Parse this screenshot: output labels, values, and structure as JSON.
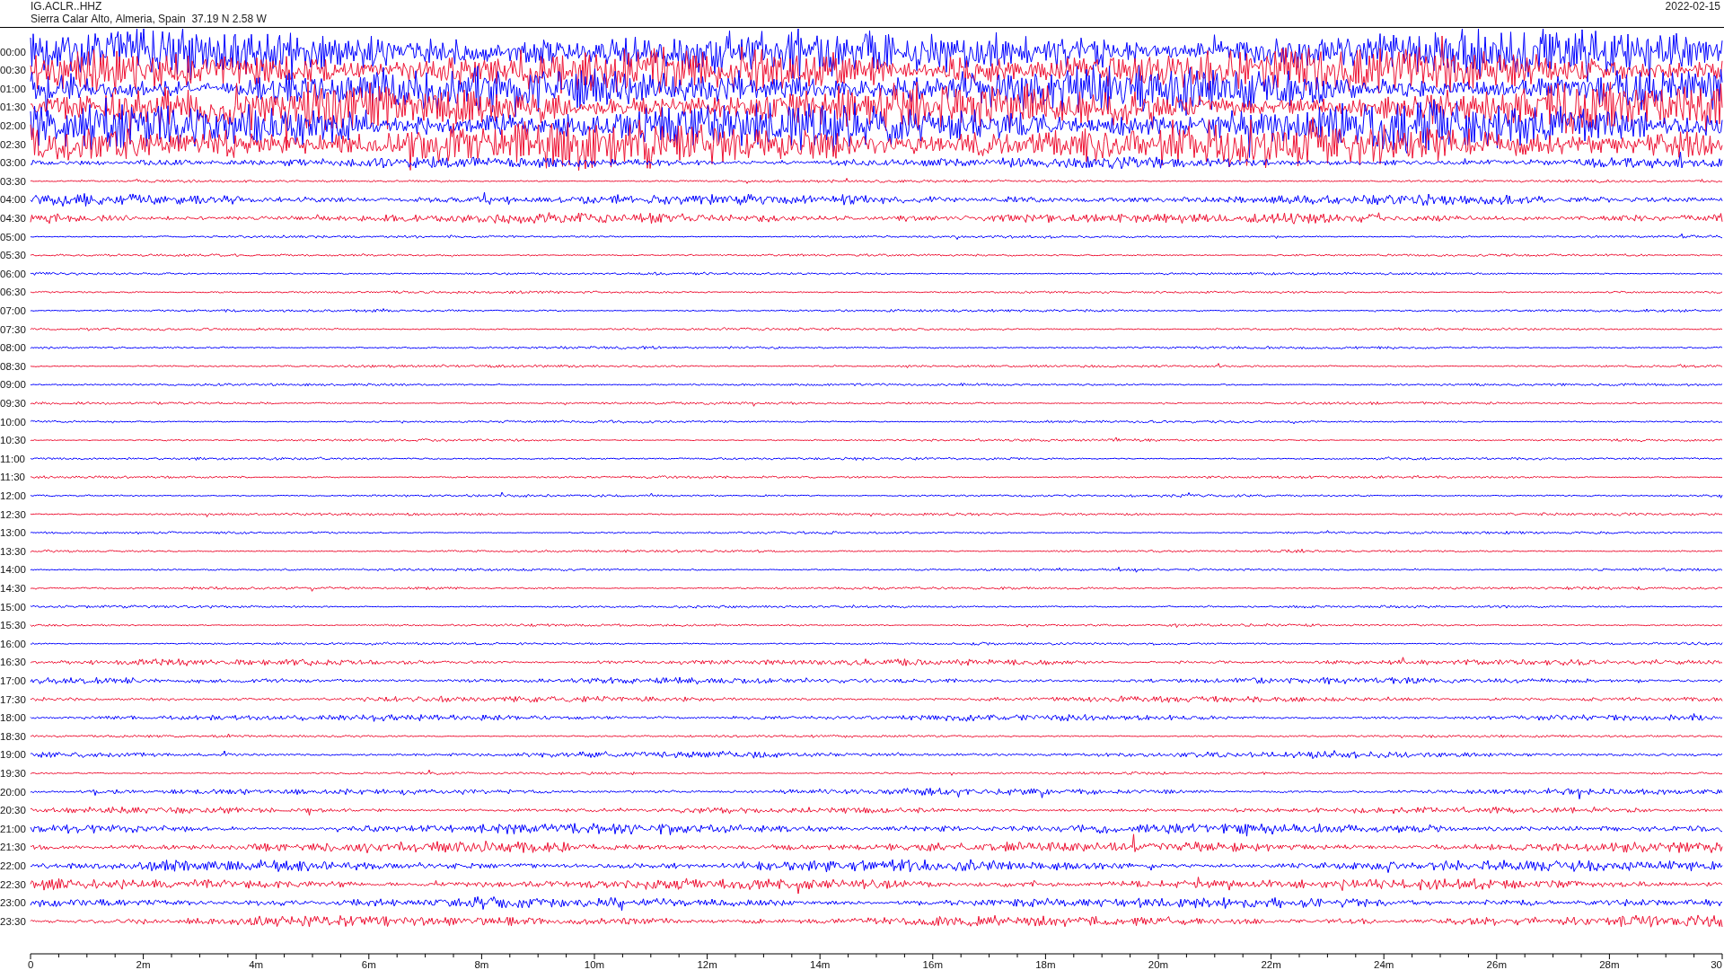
{
  "header": {
    "station": "IG.ACLR..HHZ",
    "location": "Sierra Calar Alto, Almeria, Spain  37.19 N 2.58 W",
    "date": "2022-02-15"
  },
  "traces": [
    {
      "label": "00:00",
      "color": "#0000ff",
      "kind": "saturated"
    },
    {
      "label": "00:30",
      "color": "#ee1133",
      "kind": "saturated"
    },
    {
      "label": "01:00",
      "color": "#0000ff",
      "kind": "saturated"
    },
    {
      "label": "01:30",
      "color": "#ee1133",
      "kind": "saturated"
    },
    {
      "label": "02:00",
      "color": "#0000ff",
      "kind": "saturated"
    },
    {
      "label": "02:30",
      "color": "#ee1133",
      "kind": "saturated"
    },
    {
      "label": "03:00",
      "color": "#0000ff",
      "kind": "strong"
    },
    {
      "label": "03:30",
      "color": "#ee1133",
      "kind": "quiet"
    },
    {
      "label": "04:00",
      "color": "#0000ff",
      "kind": "strong"
    },
    {
      "label": "04:30",
      "color": "#ee1133",
      "kind": "strong"
    },
    {
      "label": "05:00",
      "color": "#0000ff",
      "kind": "quiet"
    },
    {
      "label": "05:30",
      "color": "#ee1133",
      "kind": "quiet"
    },
    {
      "label": "06:00",
      "color": "#0000ff",
      "kind": "quiet"
    },
    {
      "label": "06:30",
      "color": "#ee1133",
      "kind": "quiet"
    },
    {
      "label": "07:00",
      "color": "#0000ff",
      "kind": "quiet"
    },
    {
      "label": "07:30",
      "color": "#ee1133",
      "kind": "quiet"
    },
    {
      "label": "08:00",
      "color": "#0000ff",
      "kind": "quiet"
    },
    {
      "label": "08:30",
      "color": "#ee1133",
      "kind": "quiet"
    },
    {
      "label": "09:00",
      "color": "#0000ff",
      "kind": "quiet"
    },
    {
      "label": "09:30",
      "color": "#ee1133",
      "kind": "quiet"
    },
    {
      "label": "10:00",
      "color": "#0000ff",
      "kind": "quiet"
    },
    {
      "label": "10:30",
      "color": "#ee1133",
      "kind": "quiet"
    },
    {
      "label": "11:00",
      "color": "#0000ff",
      "kind": "quiet"
    },
    {
      "label": "11:30",
      "color": "#ee1133",
      "kind": "quiet"
    },
    {
      "label": "12:00",
      "color": "#0000ff",
      "kind": "quiet"
    },
    {
      "label": "12:30",
      "color": "#ee1133",
      "kind": "quiet"
    },
    {
      "label": "13:00",
      "color": "#0000ff",
      "kind": "quiet"
    },
    {
      "label": "13:30",
      "color": "#ee1133",
      "kind": "quiet"
    },
    {
      "label": "14:00",
      "color": "#0000ff",
      "kind": "quiet"
    },
    {
      "label": "14:30",
      "color": "#ee1133",
      "kind": "quiet"
    },
    {
      "label": "15:00",
      "color": "#0000ff",
      "kind": "quiet"
    },
    {
      "label": "15:30",
      "color": "#ee1133",
      "kind": "quiet"
    },
    {
      "label": "16:00",
      "color": "#0000ff",
      "kind": "quiet"
    },
    {
      "label": "16:30",
      "color": "#ee1133",
      "kind": "moderate"
    },
    {
      "label": "17:00",
      "color": "#0000ff",
      "kind": "moderate"
    },
    {
      "label": "17:30",
      "color": "#ee1133",
      "kind": "moderate"
    },
    {
      "label": "18:00",
      "color": "#0000ff",
      "kind": "moderate"
    },
    {
      "label": "18:30",
      "color": "#ee1133",
      "kind": "quiet"
    },
    {
      "label": "19:00",
      "color": "#0000ff",
      "kind": "moderate"
    },
    {
      "label": "19:30",
      "color": "#ee1133",
      "kind": "quiet"
    },
    {
      "label": "20:00",
      "color": "#0000ff",
      "kind": "moderate"
    },
    {
      "label": "20:30",
      "color": "#ee1133",
      "kind": "moderate"
    },
    {
      "label": "21:00",
      "color": "#0000ff",
      "kind": "strong"
    },
    {
      "label": "21:30",
      "color": "#ee1133",
      "kind": "strong"
    },
    {
      "label": "22:00",
      "color": "#0000ff",
      "kind": "strong"
    },
    {
      "label": "22:30",
      "color": "#ee1133",
      "kind": "strong"
    },
    {
      "label": "23:00",
      "color": "#0000ff",
      "kind": "strong"
    },
    {
      "label": "23:30",
      "color": "#ee1133",
      "kind": "strong"
    }
  ],
  "x_axis": {
    "ticks": [
      "0",
      "2m",
      "4m",
      "6m",
      "8m",
      "10m",
      "12m",
      "14m",
      "16m",
      "18m",
      "20m",
      "22m",
      "24m",
      "26m",
      "28m",
      "30"
    ]
  }
}
